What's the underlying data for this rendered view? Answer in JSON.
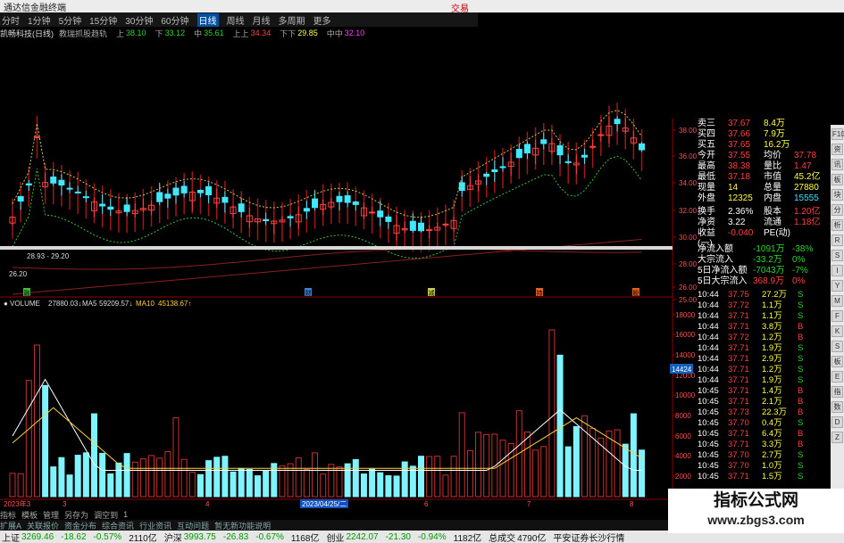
{
  "window": {
    "title": "通达信金融终端",
    "trade_label": "交易"
  },
  "menu": {
    "items": [
      "分时",
      "1分钟",
      "5分钟",
      "15分钟",
      "30分钟",
      "60分钟",
      "日线",
      "周线",
      "月线",
      "多周期",
      "更多"
    ],
    "active_index": 6
  },
  "info": {
    "stock": "凯畅科技(日线)",
    "indicator": "教瑞抓股趋轨",
    "fields": [
      {
        "label": "上",
        "value": "38.10",
        "color": "dn"
      },
      {
        "label": "下",
        "value": "33.12",
        "color": "dn"
      },
      {
        "label": "中",
        "value": "35.61",
        "color": "dn"
      },
      {
        "label": "上上",
        "value": "34.34",
        "color": "up"
      },
      {
        "label": "下下",
        "value": "29.85",
        "color": "yl"
      },
      {
        "label": "中中",
        "value": "32.10",
        "color": "mg"
      }
    ]
  },
  "price_axis": [
    "38.00",
    "36.00",
    "34.00",
    "32.00",
    "30.00",
    "28.00",
    "26.00",
    "25.00"
  ],
  "volume_axis": [
    "18000",
    "16000",
    "14000",
    "12000",
    "10000",
    "8000",
    "6000",
    "4000",
    "2000"
  ],
  "annotations": {
    "box_range": "28.93 - 29.20",
    "low_label": "26.20",
    "crosshair_value": "14424",
    "date_cursor": "2023/04/25/二",
    "axis_start": "2023年3",
    "month_ticks": [
      "3",
      "4",
      "5",
      "6",
      "7",
      "8"
    ],
    "event_markers": [
      "融",
      "财",
      "减",
      "持",
      "股"
    ]
  },
  "volume_header": {
    "name": "VOLUME",
    "value": "27880.03↓",
    "ma5_label": "MA5",
    "ma5": "59209.57↓",
    "ma10_label": "MA10",
    "ma10": "45138.67↑"
  },
  "quote": {
    "asks": [
      {
        "label": "卖三",
        "price": "37.67",
        "vol": "8.4万"
      },
      {
        "label": "买四",
        "price": "37.66",
        "vol": "7.9万"
      },
      {
        "label": "买五",
        "price": "37.65",
        "vol": "16.2万"
      }
    ],
    "stats": [
      {
        "l1": "今开",
        "v1": "37.55",
        "l2": "均价",
        "v2": "37.78"
      },
      {
        "l1": "最高",
        "v1": "38.38",
        "l2": "量比",
        "v2": "1.47"
      },
      {
        "l1": "最低",
        "v1": "37.18",
        "l2": "市值",
        "v2": "45.2亿"
      },
      {
        "l1": "现量",
        "v1": "14",
        "l2": "总量",
        "v2": "27880"
      },
      {
        "l1": "外盘",
        "v1": "12325",
        "l2": "内盘",
        "v2": "15555"
      },
      {
        "l1": "换手",
        "v1": "2.36%",
        "l2": "股本",
        "v2": "1.20亿"
      },
      {
        "l1": "净资",
        "v1": "3.22",
        "l2": "流通",
        "v2": "1.18亿"
      },
      {
        "l1": "收益(一)",
        "v1": "-0.040",
        "l2": "PE(动)",
        "v2": ""
      }
    ],
    "flows": [
      {
        "label": "净流入额",
        "value": "-1091万",
        "pct": "-38%"
      },
      {
        "label": "大宗流入",
        "value": "-33.2万",
        "pct": "0%"
      },
      {
        "label": "5日净流入额",
        "value": "-7043万",
        "pct": "-7%"
      },
      {
        "label": "5日大宗流入",
        "value": "368.9万",
        "pct": "0%"
      }
    ],
    "ticks": [
      {
        "t": "10:44",
        "p": "37.75",
        "v": "27.2万",
        "d": "S"
      },
      {
        "t": "10:44",
        "p": "37.72",
        "v": "1.1万",
        "d": "S"
      },
      {
        "t": "10:44",
        "p": "37.71",
        "v": "1.1万",
        "d": "S"
      },
      {
        "t": "10:44",
        "p": "37.71",
        "v": "3.8万",
        "d": "B"
      },
      {
        "t": "10:44",
        "p": "37.72",
        "v": "1.2万",
        "d": "B"
      },
      {
        "t": "10:44",
        "p": "37.71",
        "v": "1.9万",
        "d": "S"
      },
      {
        "t": "10:44",
        "p": "37.71",
        "v": "2.9万",
        "d": "S"
      },
      {
        "t": "10:44",
        "p": "37.71",
        "v": "1.2万",
        "d": "S"
      },
      {
        "t": "10:44",
        "p": "37.71",
        "v": "1.9万",
        "d": "S"
      },
      {
        "t": "10:45",
        "p": "37.71",
        "v": "1.4万",
        "d": "B"
      },
      {
        "t": "10:45",
        "p": "37.71",
        "v": "2.1万",
        "d": "B"
      },
      {
        "t": "10:45",
        "p": "37.73",
        "v": "22.3万",
        "d": "B"
      },
      {
        "t": "10:45",
        "p": "37.70",
        "v": "0.4万",
        "d": "S"
      },
      {
        "t": "10:45",
        "p": "37.71",
        "v": "6.4万",
        "d": "B"
      },
      {
        "t": "10:45",
        "p": "37.71",
        "v": "3.3万",
        "d": "B"
      },
      {
        "t": "10:45",
        "p": "37.70",
        "v": "2.7万",
        "d": "S"
      },
      {
        "t": "10:45",
        "p": "37.70",
        "v": "1.0万",
        "d": "S"
      },
      {
        "t": "10:45",
        "p": "37.71",
        "v": "1.5万",
        "d": "S"
      }
    ]
  },
  "bottom_tabs": [
    "指标",
    "模板",
    "管理",
    "另存为",
    "调空到",
    "1"
  ],
  "bottom_tabs2": [
    "扩展A",
    "关联报价",
    "资金分布",
    "综合资讯",
    "行业资讯",
    "互动问题",
    "暂无新功能说明"
  ],
  "status": {
    "items": [
      {
        "name": "上证",
        "v": "3269.46",
        "c": "-18.62",
        "p": "-0.57%",
        "amt": "2110亿"
      },
      {
        "name": "沪深",
        "v": "3993.75",
        "c": "-26.83",
        "p": "-0.67%",
        "amt": "1168亿"
      },
      {
        "name": "创业",
        "v": "2242.07",
        "c": "-21.30",
        "p": "-0.94%",
        "amt": "1182亿"
      }
    ],
    "total_label": "总成交",
    "total": "4790亿",
    "broker": "平安证券长沙行情"
  },
  "sidebar": [
    "F10",
    "资",
    "讯",
    "板",
    "块",
    "分",
    "析",
    "R",
    "S",
    "I",
    "Y",
    "M",
    "F",
    "K",
    "S",
    "板",
    "E",
    "指",
    "数",
    "D",
    "Z"
  ],
  "watermark": {
    "line1": "指标公式网",
    "line2": "www.zbgs3.com"
  },
  "colors": {
    "up": "#ff4040",
    "down": "#2bd62b",
    "volume_bar": "#7ff3ff",
    "volume_red": "#c83030"
  }
}
